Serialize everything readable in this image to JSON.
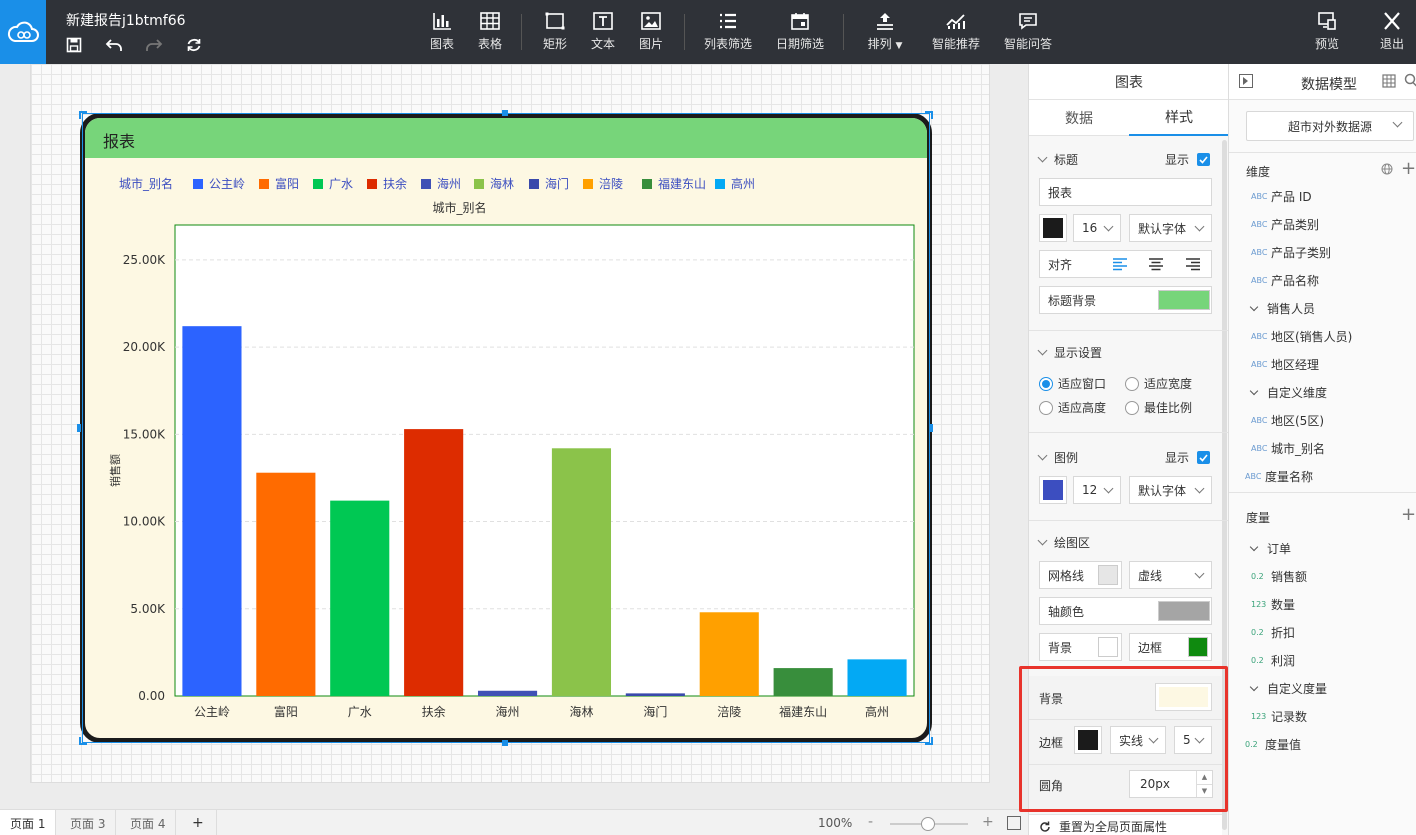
{
  "topbar": {
    "doc_title": "新建报告j1btmf66",
    "tools": {
      "chart": "图表",
      "table": "表格",
      "rect": "矩形",
      "text": "文本",
      "image": "图片",
      "list_filter": "列表筛选",
      "date_filter": "日期筛选",
      "arrange": "排列",
      "smart_recommend": "智能推荐",
      "smart_qa": "智能问答",
      "preview": "预览",
      "exit": "退出"
    }
  },
  "chart_data": {
    "type": "bar",
    "title": "报表",
    "xlabel": "城市_别名",
    "ylabel": "销售额",
    "legend_title": "城市_别名",
    "categories": [
      "公主岭",
      "富阳",
      "广水",
      "扶余",
      "海州",
      "海林",
      "海门",
      "涪陵",
      "福建东山",
      "高州"
    ],
    "values": [
      21200,
      12800,
      11200,
      15300,
      300,
      14200,
      150,
      4800,
      1600,
      2100
    ],
    "colors": [
      "#2c63ff",
      "#ff6b00",
      "#00c853",
      "#dd2c00",
      "#3f51b5",
      "#8bc34a",
      "#3949ab",
      "#ffa000",
      "#388e3c",
      "#03a9f4"
    ],
    "yticks": [
      "0.00",
      "5.00K",
      "10.00K",
      "15.00K",
      "20.00K",
      "25.00K"
    ],
    "ylim": [
      0,
      27000
    ],
    "grid": true,
    "legend_position": "top-left"
  },
  "bottom": {
    "pages": [
      "页面 1",
      "页面 3",
      "页面 4"
    ],
    "add": "+",
    "zoom": "100%",
    "minus": "-",
    "plus": "+"
  },
  "panel": {
    "header": "图表",
    "tab_data": "数据",
    "tab_style": "样式",
    "title_section": "标题",
    "show": "显示",
    "title_value": "报表",
    "title_font_size": "16",
    "font_family": "默认字体",
    "align": "对齐",
    "title_bg": "标题背景",
    "display_section": "显示设置",
    "fit_window": "适应窗口",
    "fit_width": "适应宽度",
    "fit_height": "适应高度",
    "best_ratio": "最佳比例",
    "legend_section": "图例",
    "legend_font_size": "12",
    "plot_section": "绘图区",
    "gridline": "网格线",
    "gridline_style": "虚线",
    "axis_color": "轴颜色",
    "background": "背景",
    "border": "边框",
    "comp_background": "背景",
    "comp_border": "边框",
    "border_style": "实线",
    "border_width": "5",
    "radius": "圆角",
    "radius_value": "20px",
    "reset": "重置为全局页面属性"
  },
  "colors": {
    "title_color": "#1b1b1b",
    "title_bg": "#77d57a",
    "legend_color": "#3c4ec0",
    "axis_color": "#a5a5a5",
    "plot_border": "#0f8a0f",
    "component_bg": "#fdf8e3",
    "component_border": "#1b1b1b",
    "accent": "#1a8fe8"
  },
  "model": {
    "title": "数据模型",
    "source": "超市对外数据源",
    "dim_header": "维度",
    "dimensions": [
      {
        "type": "ABC",
        "name": "产品 ID",
        "level": 1
      },
      {
        "type": "ABC",
        "name": "产品类别",
        "level": 1
      },
      {
        "type": "ABC",
        "name": "产品子类别",
        "level": 1
      },
      {
        "type": "ABC",
        "name": "产品名称",
        "level": 1
      },
      {
        "type": "folder",
        "name": "销售人员",
        "level": 0
      },
      {
        "type": "ABC",
        "name": "地区(销售人员)",
        "level": 1
      },
      {
        "type": "ABC",
        "name": "地区经理",
        "level": 1
      },
      {
        "type": "folder",
        "name": "自定义维度",
        "level": 0
      },
      {
        "type": "ABC",
        "name": "地区(5区)",
        "level": 1
      },
      {
        "type": "ABC",
        "name": "城市_别名",
        "level": 1
      },
      {
        "type": "ABC",
        "name": "度量名称",
        "level": 0
      }
    ],
    "meas_header": "度量",
    "measures": [
      {
        "type": "folder",
        "name": "订单",
        "level": 0
      },
      {
        "type": "0.2",
        "name": "销售额",
        "level": 1
      },
      {
        "type": "123",
        "name": "数量",
        "level": 1
      },
      {
        "type": "0.2",
        "name": "折扣",
        "level": 1
      },
      {
        "type": "0.2",
        "name": "利润",
        "level": 1
      },
      {
        "type": "folder",
        "name": "自定义度量",
        "level": 0
      },
      {
        "type": "123",
        "name": "记录数",
        "level": 1
      },
      {
        "type": "0.2",
        "name": "度量值",
        "level": 0
      }
    ]
  }
}
